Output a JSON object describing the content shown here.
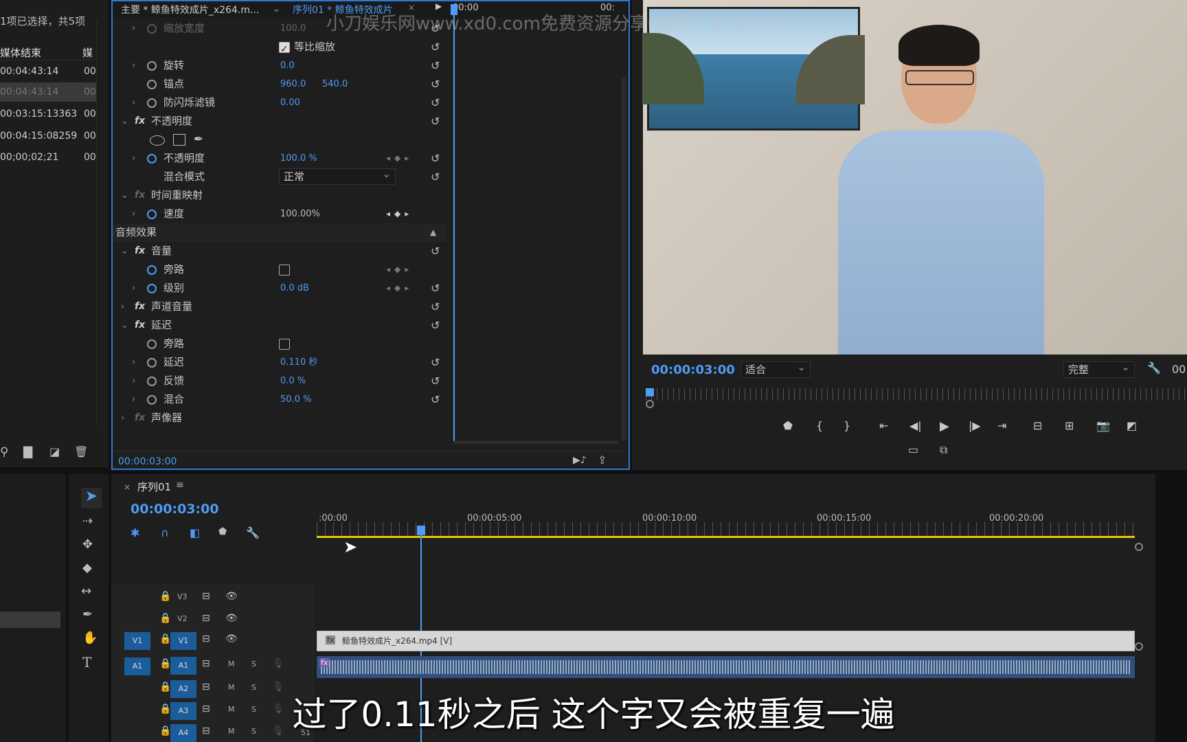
{
  "watermark": "小刀娱乐网www.xd0.com免费资源分享QQ群：1532276",
  "project": {
    "selection_status": "1项已选择，共5项",
    "col_media_end": "媒体结束",
    "col_media_short": "媒",
    "rows": [
      {
        "end": "00:04:43:14",
        "c2": "00"
      },
      {
        "end": "00:04:43:14",
        "c2": "00"
      },
      {
        "end": "00:03:15:13363",
        "c2": "00"
      },
      {
        "end": "00:04:15:08259",
        "c2": "00"
      },
      {
        "end": "00;00;02;21",
        "c2": "00"
      }
    ]
  },
  "effect_controls": {
    "tab_master": "主要 * 鲸鱼特效成片_x264.m...",
    "tab_sequence": "序列01 * 鲸鱼特效成片",
    "time_start": "00:00",
    "time_end": "00:",
    "current_time": "00:00:03:00",
    "rows": {
      "scale_width": {
        "label": "缩放宽度",
        "value": "100.0"
      },
      "uniform_scale": {
        "label": "等比缩放",
        "checked": true
      },
      "rotation": {
        "label": "旋转",
        "value": "0.0"
      },
      "anchor": {
        "label": "锚点",
        "x": "960.0",
        "y": "540.0"
      },
      "anti_flicker": {
        "label": "防闪烁滤镜",
        "value": "0.00"
      },
      "opacity_group": {
        "label": "不透明度"
      },
      "opacity": {
        "label": "不透明度",
        "value": "100.0 %"
      },
      "blend_mode": {
        "label": "混合模式",
        "value": "正常"
      },
      "time_remap": {
        "label": "时间重映射"
      },
      "speed": {
        "label": "速度",
        "value": "100.00%"
      },
      "audio_effects": {
        "label": "音频效果"
      },
      "volume": {
        "label": "音量"
      },
      "bypass1": {
        "label": "旁路"
      },
      "level": {
        "label": "级别",
        "value": "0.0 dB"
      },
      "channel_volume": {
        "label": "声道音量"
      },
      "delay_group": {
        "label": "延迟"
      },
      "bypass2": {
        "label": "旁路"
      },
      "delay": {
        "label": "延迟",
        "value": "0.110 秒"
      },
      "feedback": {
        "label": "反馈",
        "value": "0.0 %"
      },
      "mix": {
        "label": "混合",
        "value": "50.0 %"
      },
      "panner": {
        "label": "声像器"
      }
    }
  },
  "program_monitor": {
    "timecode": "00:00:03:00",
    "fit": "适合",
    "quality": "完整",
    "right_time": "00"
  },
  "timeline": {
    "tab_title": "序列01",
    "timecode": "00:00:03:00",
    "ticks": [
      ":00:00",
      "00:00:05:00",
      "00:00:10:00",
      "00:00:15:00",
      "00:00:20:00"
    ],
    "tracks": [
      {
        "src": "",
        "name": "V3",
        "kind": "video"
      },
      {
        "src": "",
        "name": "V2",
        "kind": "video"
      },
      {
        "src": "V1",
        "name": "V1",
        "kind": "video"
      },
      {
        "src": "A1",
        "name": "A1",
        "kind": "audio"
      },
      {
        "src": "",
        "name": "A2",
        "kind": "audio"
      },
      {
        "src": "",
        "name": "A3",
        "kind": "audio"
      },
      {
        "src": "",
        "name": "A4",
        "kind": "audio"
      }
    ],
    "mute_label": "M",
    "solo_label": "S",
    "clip_video_name": "鲸鱼特效成片_x264.mp4 [V]",
    "audio_meter_level": "51"
  },
  "subtitle": "过了0.11秒之后 这个字又会被重复一遍",
  "colors": {
    "accent_blue": "#4d9cf5",
    "playhead_blue": "#2d7ad6",
    "work_area": "#e6c800"
  }
}
